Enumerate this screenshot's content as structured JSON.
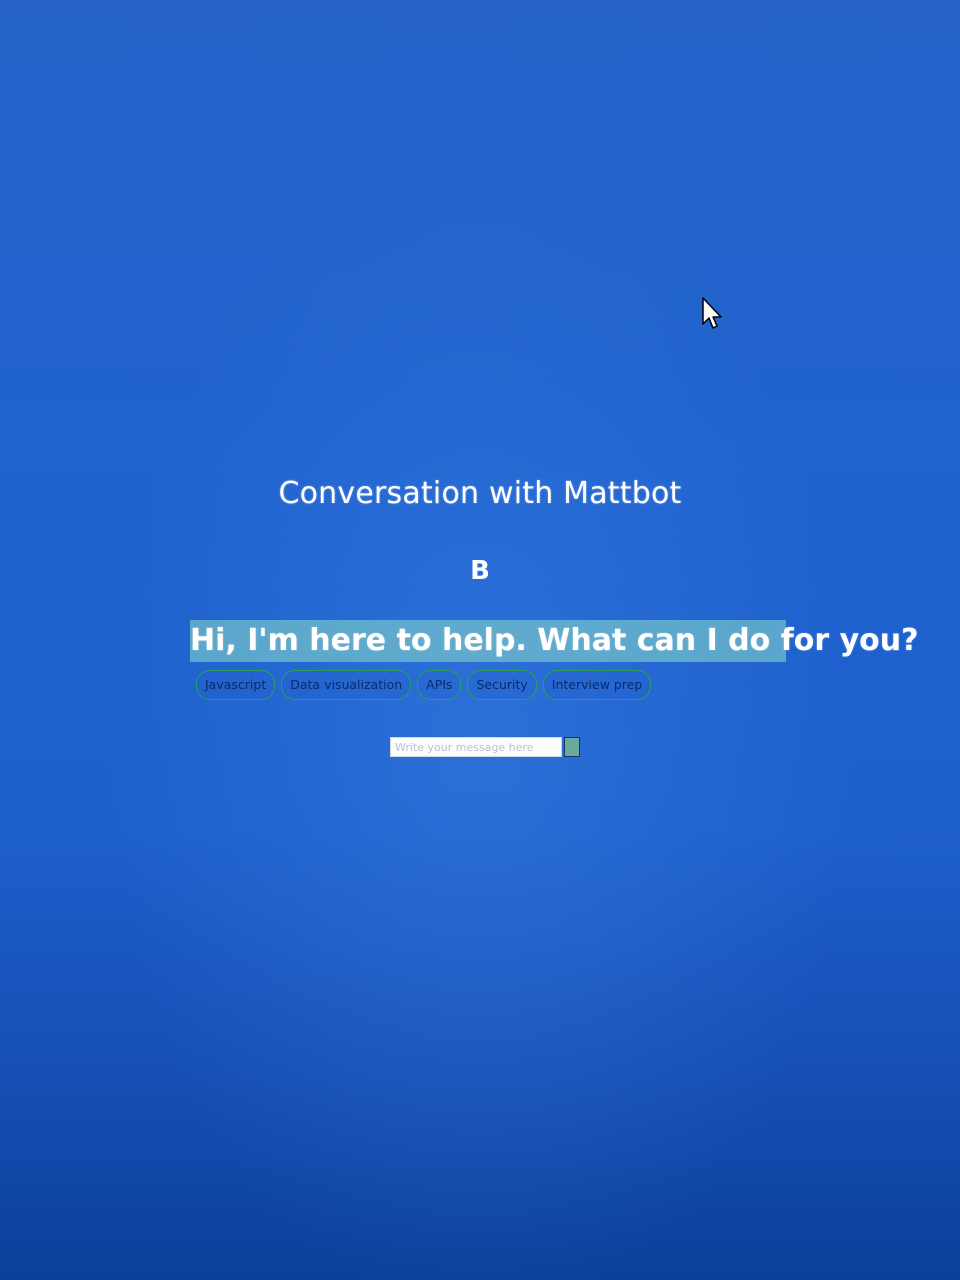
{
  "chat": {
    "title": "Conversation with Mattbot",
    "avatar_letter": "B",
    "greeting": "Hi, I'm here to help. What can I do for you?",
    "suggestions": [
      "Javascript",
      "Data visualization",
      "APIs",
      "Security",
      "Interview prep"
    ],
    "input_placeholder": "Write your message here"
  },
  "icons": {
    "pointer": "mouse-pointer-icon",
    "send": "send-icon"
  },
  "colors": {
    "background": "#1f62cf",
    "greeting_highlight": "#8cdcc8",
    "chip_border": "#2ea04d",
    "send_button": "#6aaa9c"
  }
}
